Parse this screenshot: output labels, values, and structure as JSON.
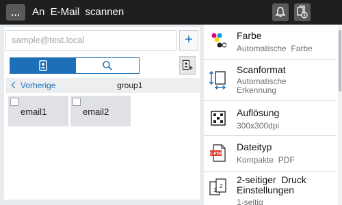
{
  "header": {
    "menu_label": "...",
    "title": "An  E-Mail  scannen",
    "icons": [
      "bell-icon",
      "job-status-icon"
    ]
  },
  "destination": {
    "email_placeholder": "sample@test.local",
    "add_label": "+"
  },
  "addressbook": {
    "tabs": [
      "addressbook-icon",
      "search-icon"
    ],
    "active_tab": 0,
    "prev_label": "Vorherige",
    "group_label": "group1",
    "entries": [
      {
        "label": "email1"
      },
      {
        "label": "email2"
      }
    ]
  },
  "settings": [
    {
      "icon": "color-icon",
      "title": "Farbe",
      "value": "Automatische  Farbe"
    },
    {
      "icon": "scan-size-icon",
      "title": "Scanformat",
      "value_line1": "Automatische",
      "value_line2": "Erkennung"
    },
    {
      "icon": "resolution-icon",
      "title": "Auflösung",
      "value": "300x300dpi"
    },
    {
      "icon": "pdf-file-icon",
      "title": "Dateityp",
      "value": "Kompakte  PDF"
    },
    {
      "icon": "duplex-icon",
      "title_line1": "2-seitiger  Druck",
      "title_line2": "Einstellungen",
      "value": "1-seitig"
    }
  ],
  "colors": {
    "topbar": "#1f1f1f",
    "accent_blue": "#1d6fb8",
    "pdf_red": "#d9362b"
  }
}
